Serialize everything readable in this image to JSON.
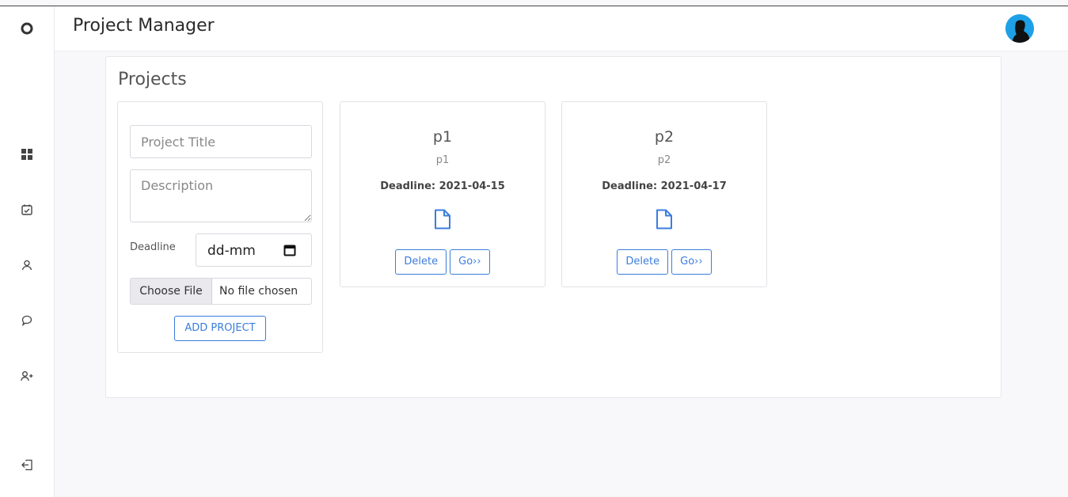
{
  "header": {
    "title": "Project Manager"
  },
  "sidebar": {
    "items": [
      {
        "icon": "dashboard-icon"
      },
      {
        "icon": "tasks-icon"
      },
      {
        "icon": "user-icon"
      },
      {
        "icon": "chat-icon"
      },
      {
        "icon": "add-user-icon"
      },
      {
        "icon": "logout-icon"
      }
    ]
  },
  "projects": {
    "title": "Projects",
    "form": {
      "title_placeholder": "Project Title",
      "description_placeholder": "Description",
      "deadline_label": "Deadline",
      "deadline_value": "dd-mm",
      "choose_file_label": "Choose File",
      "file_status": "No file chosen",
      "add_button": "ADD PROJECT"
    },
    "cards": [
      {
        "title": "p1",
        "description": "p1",
        "deadline": "Deadline: 2021-04-15",
        "delete_label": "Delete",
        "go_label": "Go››"
      },
      {
        "title": "p2",
        "description": "p2",
        "deadline": "Deadline: 2021-04-17",
        "delete_label": "Delete",
        "go_label": "Go››"
      }
    ]
  },
  "colors": {
    "accent": "#3b7ddd",
    "avatar_bg": "#1ea0e6"
  }
}
